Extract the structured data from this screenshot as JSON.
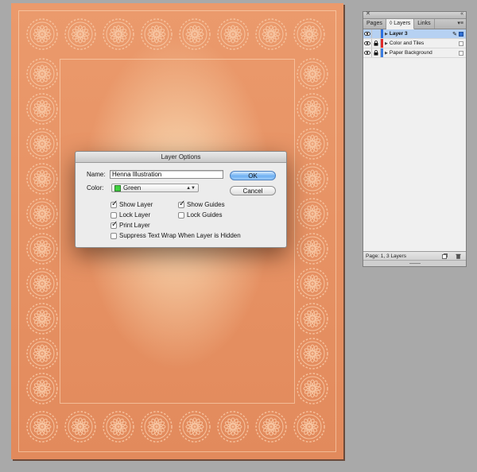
{
  "document": {
    "background_color": "#e8956a",
    "ornament_color": "#f4b791",
    "medallion_count": 34
  },
  "layers_panel": {
    "tabs": [
      {
        "label": "Pages",
        "active": false
      },
      {
        "label": "◊ Layers",
        "active": true
      },
      {
        "label": "Links",
        "active": false
      }
    ],
    "layers": [
      {
        "name": "Layer 3",
        "color": "#2a6fe0",
        "selected": true,
        "locked": false,
        "visible": true
      },
      {
        "name": "Color and Tiles",
        "color": "#e02a2a",
        "selected": false,
        "locked": true,
        "visible": true
      },
      {
        "name": "Paper Background",
        "color": "#3b7de0",
        "selected": false,
        "locked": true,
        "visible": true
      }
    ],
    "status": "Page: 1, 3 Layers"
  },
  "dialog": {
    "title": "Layer Options",
    "name_label": "Name:",
    "name_value": "Henna Illustration",
    "color_label": "Color:",
    "color_value": "Green",
    "color_swatch": "#3fd13f",
    "ok_label": "OK",
    "cancel_label": "Cancel",
    "checkboxes": {
      "show_layer": {
        "label": "Show Layer",
        "checked": true
      },
      "show_guides": {
        "label": "Show Guides",
        "checked": true
      },
      "lock_layer": {
        "label": "Lock Layer",
        "checked": false
      },
      "lock_guides": {
        "label": "Lock Guides",
        "checked": false
      },
      "print_layer": {
        "label": "Print Layer",
        "checked": true
      },
      "suppress_wrap": {
        "label": "Suppress Text Wrap When Layer is Hidden",
        "checked": false
      }
    }
  }
}
